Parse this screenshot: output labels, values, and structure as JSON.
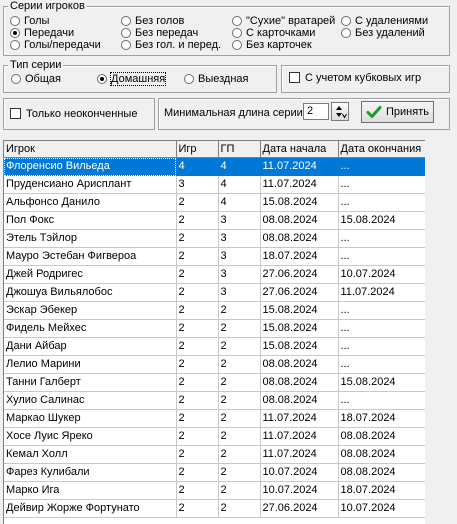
{
  "players_group": {
    "title": "Серии игроков",
    "options": [
      {
        "label": "Голы",
        "selected": false
      },
      {
        "label": "Без голов",
        "selected": false
      },
      {
        "label": "\"Сухие\" вратарей",
        "selected": false
      },
      {
        "label": "С удалениями",
        "selected": false
      },
      {
        "label": "Передачи",
        "selected": true
      },
      {
        "label": "Без передач",
        "selected": false
      },
      {
        "label": "С карточками",
        "selected": false
      },
      {
        "label": "Без удалений",
        "selected": false
      },
      {
        "label": "Голы/передачи",
        "selected": false
      },
      {
        "label": "Без гол. и перед.",
        "selected": false
      },
      {
        "label": "Без карточек",
        "selected": false
      }
    ]
  },
  "series_type": {
    "title": "Тип серии",
    "options": [
      {
        "label": "Общая",
        "selected": false
      },
      {
        "label": "Домашняя",
        "selected": true
      },
      {
        "label": "Выездная",
        "selected": false
      }
    ]
  },
  "cup_games": {
    "label": "С учетом кубковых игр",
    "checked": false
  },
  "unfinished_only": {
    "label": "Только неоконченные",
    "checked": false
  },
  "min_length": {
    "label": "Минимальная длина серии",
    "value": "2"
  },
  "accept_button": {
    "label": "Принять"
  },
  "table": {
    "columns": [
      "Игрок",
      "Игр",
      "ГП",
      "Дата начала",
      "Дата окончания"
    ],
    "selected_row": 0,
    "rows": [
      [
        "Флоренсио Вильеда",
        "4",
        "4",
        "11.07.2024",
        "..."
      ],
      [
        "Пруденсиано Арисплант",
        "3",
        "4",
        "11.07.2024",
        "..."
      ],
      [
        "Альфонсо Данило",
        "2",
        "4",
        "15.08.2024",
        "..."
      ],
      [
        "Пол Фокс",
        "2",
        "3",
        "08.08.2024",
        "15.08.2024"
      ],
      [
        "Этель Тэйлор",
        "2",
        "3",
        "08.08.2024",
        "..."
      ],
      [
        "Мауро Эстебан Фигвероа",
        "2",
        "3",
        "18.07.2024",
        "..."
      ],
      [
        "Джей Родригес",
        "2",
        "3",
        "27.06.2024",
        "10.07.2024"
      ],
      [
        "Джошуа Вильялобос",
        "2",
        "3",
        "27.06.2024",
        "11.07.2024"
      ],
      [
        "Эскар Эбекер",
        "2",
        "2",
        "15.08.2024",
        "..."
      ],
      [
        "Фидель Мейхес",
        "2",
        "2",
        "15.08.2024",
        "..."
      ],
      [
        "Дани Айбар",
        "2",
        "2",
        "15.08.2024",
        "..."
      ],
      [
        "Лелио Марини",
        "2",
        "2",
        "08.08.2024",
        "..."
      ],
      [
        "Танни Галберт",
        "2",
        "2",
        "08.08.2024",
        "15.08.2024"
      ],
      [
        "Хулио Салинас",
        "2",
        "2",
        "08.08.2024",
        "..."
      ],
      [
        "Маркао Шукер",
        "2",
        "2",
        "11.07.2024",
        "18.07.2024"
      ],
      [
        "Хосе Луис Яреко",
        "2",
        "2",
        "11.07.2024",
        "08.08.2024"
      ],
      [
        "Кемал Холл",
        "2",
        "2",
        "11.07.2024",
        "08.08.2024"
      ],
      [
        "Фарез Кулибали",
        "2",
        "2",
        "10.07.2024",
        "08.08.2024"
      ],
      [
        "Марко Ига",
        "2",
        "2",
        "10.07.2024",
        "18.07.2024"
      ],
      [
        "Дейвир Жорже Фортунато",
        "2",
        "2",
        "27.06.2024",
        "10.07.2024"
      ]
    ]
  }
}
